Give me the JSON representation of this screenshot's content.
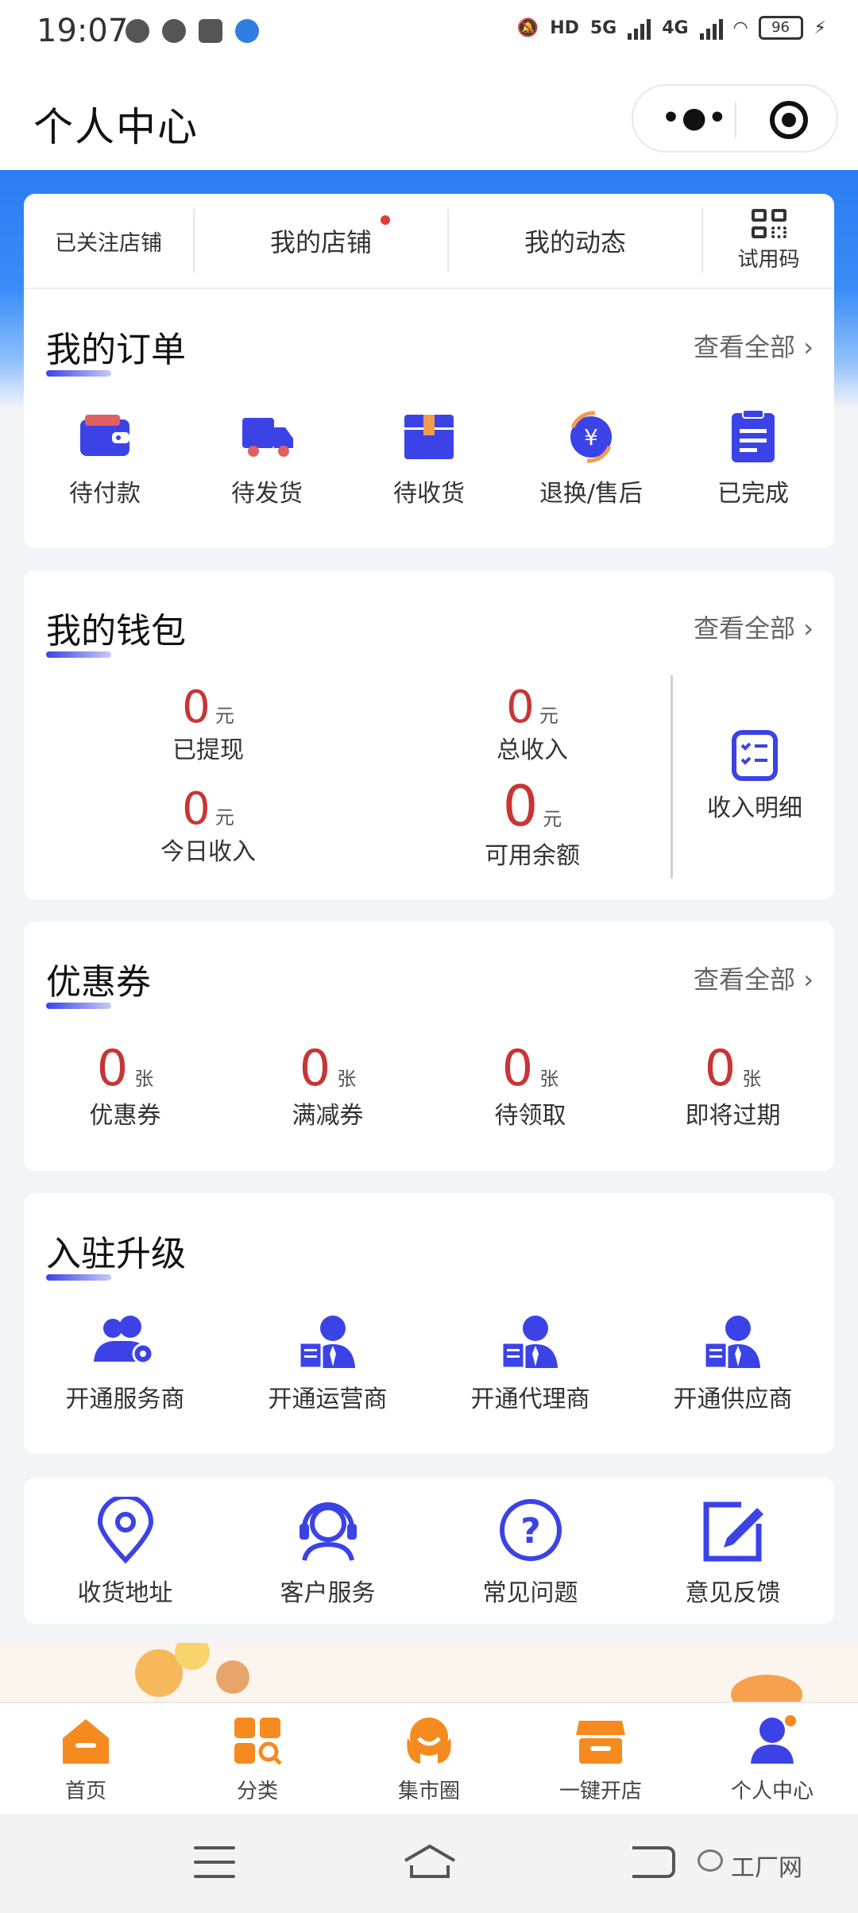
{
  "status_bar": {
    "time": "19:07",
    "network_hd": "HD",
    "network_5g": "5G",
    "network_4g": "4G",
    "battery": "96"
  },
  "header": {
    "title": "个人中心",
    "more_icon": "more-dots-icon",
    "close_icon": "target-icon"
  },
  "top_tabs": [
    {
      "label": "已关注店铺"
    },
    {
      "label": "我的店铺",
      "has_dot": true
    },
    {
      "label": "我的动态"
    },
    {
      "label": "试用码",
      "icon": "qrcode-icon"
    }
  ],
  "orders": {
    "title": "我的订单",
    "view_all": "查看全部 ›",
    "items": [
      {
        "label": "待付款",
        "icon": "wallet-icon"
      },
      {
        "label": "待发货",
        "icon": "truck-icon"
      },
      {
        "label": "待收货",
        "icon": "package-icon"
      },
      {
        "label": "退换/售后",
        "icon": "refund-icon"
      },
      {
        "label": "已完成",
        "icon": "clipboard-icon"
      }
    ]
  },
  "wallet": {
    "title": "我的钱包",
    "view_all": "查看全部 ›",
    "items": [
      {
        "value": "0",
        "unit": "元",
        "label": "已提现"
      },
      {
        "value": "0",
        "unit": "元",
        "label": "总收入"
      },
      {
        "value": "0",
        "unit": "元",
        "label": "今日收入"
      },
      {
        "value": "0",
        "unit": "元",
        "label": "可用余额"
      }
    ],
    "detail_label": "收入明细"
  },
  "coupons": {
    "title": "优惠券",
    "view_all": "查看全部 ›",
    "items": [
      {
        "value": "0",
        "unit": "张",
        "label": "优惠券"
      },
      {
        "value": "0",
        "unit": "张",
        "label": "满减券"
      },
      {
        "value": "0",
        "unit": "张",
        "label": "待领取"
      },
      {
        "value": "0",
        "unit": "张",
        "label": "即将过期"
      }
    ]
  },
  "upgrade": {
    "title": "入驻升级",
    "items": [
      {
        "label": "开通服务商",
        "icon": "service-provider-icon"
      },
      {
        "label": "开通运营商",
        "icon": "operator-icon"
      },
      {
        "label": "开通代理商",
        "icon": "agent-icon"
      },
      {
        "label": "开通供应商",
        "icon": "supplier-icon"
      }
    ]
  },
  "services": {
    "items": [
      {
        "label": "收货地址",
        "icon": "location-pin-icon"
      },
      {
        "label": "客户服务",
        "icon": "headset-icon"
      },
      {
        "label": "常见问题",
        "icon": "question-icon"
      },
      {
        "label": "意见反馈",
        "icon": "edit-icon"
      }
    ]
  },
  "tabbar": {
    "items": [
      {
        "label": "首页",
        "icon": "home-icon"
      },
      {
        "label": "分类",
        "icon": "category-icon"
      },
      {
        "label": "集市圈",
        "icon": "market-icon"
      },
      {
        "label": "一键开店",
        "icon": "shop-icon"
      },
      {
        "label": "个人中心",
        "icon": "user-icon",
        "active": true
      }
    ]
  },
  "watermark": "工厂网",
  "colors": {
    "primary_blue": "#3b43e6",
    "value_red": "#c93434",
    "tab_orange": "#f58a1f"
  }
}
